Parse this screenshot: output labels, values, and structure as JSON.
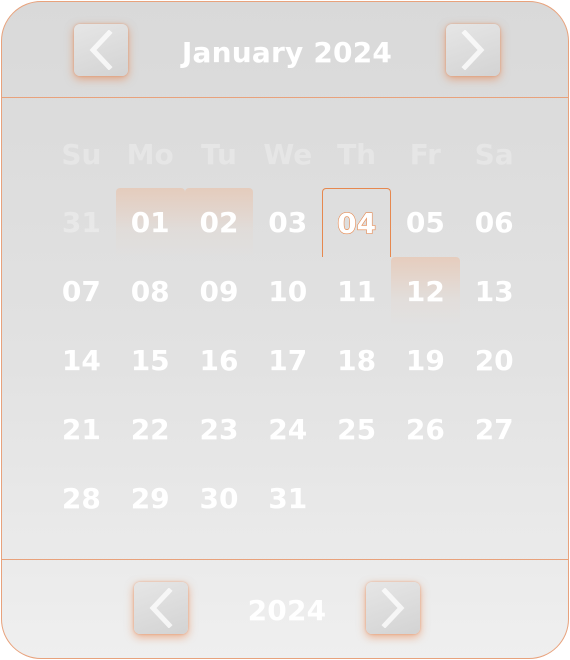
{
  "header": {
    "title": "January 2024",
    "prev_icon": "chevron-left-icon",
    "next_icon": "chevron-right-icon"
  },
  "weekdays": [
    "Su",
    "Mo",
    "Tu",
    "We",
    "Th",
    "Fr",
    "Sa"
  ],
  "days": [
    {
      "label": "31",
      "muted": true
    },
    {
      "label": "01",
      "state": "highlight"
    },
    {
      "label": "02",
      "state": "highlight"
    },
    {
      "label": "03"
    },
    {
      "label": "04",
      "state": "today"
    },
    {
      "label": "05"
    },
    {
      "label": "06"
    },
    {
      "label": "07"
    },
    {
      "label": "08"
    },
    {
      "label": "09"
    },
    {
      "label": "10"
    },
    {
      "label": "11"
    },
    {
      "label": "12",
      "state": "highlight"
    },
    {
      "label": "13"
    },
    {
      "label": "14"
    },
    {
      "label": "15"
    },
    {
      "label": "16"
    },
    {
      "label": "17"
    },
    {
      "label": "18"
    },
    {
      "label": "19"
    },
    {
      "label": "20"
    },
    {
      "label": "21"
    },
    {
      "label": "22"
    },
    {
      "label": "23"
    },
    {
      "label": "24"
    },
    {
      "label": "25"
    },
    {
      "label": "26"
    },
    {
      "label": "27"
    },
    {
      "label": "28"
    },
    {
      "label": "29"
    },
    {
      "label": "30"
    },
    {
      "label": "31"
    }
  ],
  "footer": {
    "year": "2024",
    "prev_icon": "chevron-left-icon",
    "next_icon": "chevron-right-icon"
  },
  "colors": {
    "accent": "#e6884f",
    "border": "#e8a27c",
    "text": "#ffffff",
    "background_top": "#d9d9d9",
    "background_bottom": "#efefef"
  }
}
